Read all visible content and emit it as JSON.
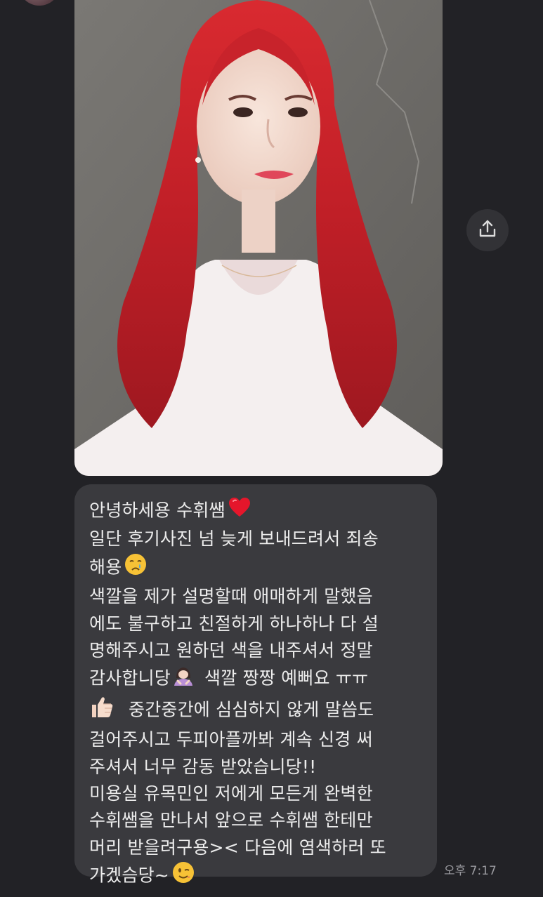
{
  "message": {
    "lines": [
      "안녕하세용 수휘쌤",
      "일단 후기사진 넘 늦게 보내드려서 죄송",
      "해용",
      "색깔을 제가 설명할때 애매하게 말했음",
      "에도 불구하고 친절하게 하나하나 다 설",
      "명해주시고 원하던 색을 내주셔서 정말",
      "감사합니당",
      "색깔 짱짱 예뻐요 ㅠㅠ",
      "중간중간에 심심하지 않게 말씀도",
      "걸어주시고 두피아플까봐 계속 신경 써",
      "주셔서 너무 감동 받았습니당!!",
      "미용실 유목민인 저에게 모든게 완벽한",
      "수휘쌤을 만나서 앞으로 수휘쌤 한테만",
      "머리 받을려구용>< 다음에 염색하러 또",
      "가겠슴당~"
    ],
    "timestamp": "오후 7:17"
  },
  "icons": {
    "heart": "red-heart-icon",
    "crying": "crying-face-icon",
    "bowing": "bowing-woman-icon",
    "thumbs_up": "thumbs-up-icon",
    "wink": "winking-face-icon",
    "share": "share-icon"
  },
  "colors": {
    "background": "#222226",
    "bubble": "#3a3a3e",
    "text": "#ececec",
    "timestamp": "#9b9ba0",
    "hair": "#c8232b"
  }
}
